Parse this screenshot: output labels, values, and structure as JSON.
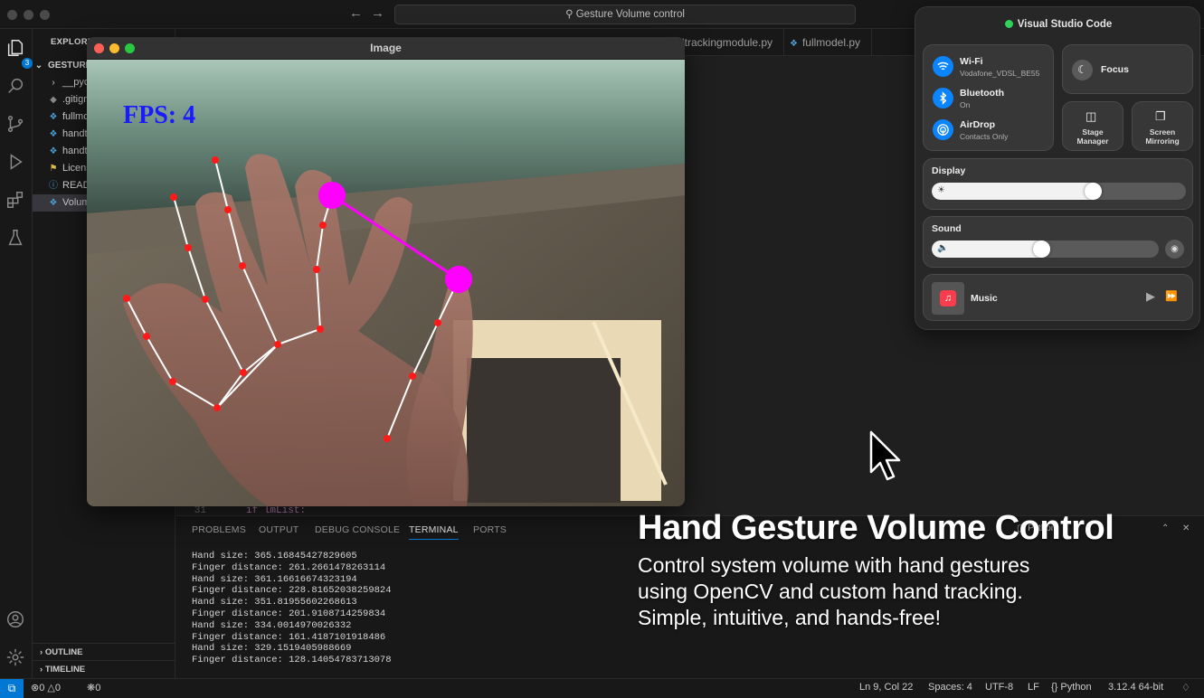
{
  "titlebar": {
    "search_text": "Gesture Volume control"
  },
  "activity": {
    "explorer_badge": "3"
  },
  "sidebar": {
    "header": "EXPLORER",
    "folder": "GESTURE",
    "items": [
      {
        "label": "__pycache__",
        "icon": "chevron-right-icon"
      },
      {
        "label": ".gitignore",
        "icon": "git-icon"
      },
      {
        "label": "fullmodel.py",
        "icon": "python-icon"
      },
      {
        "label": "handtracking.py",
        "icon": "python-icon"
      },
      {
        "label": "handtrackingmodule.py",
        "icon": "python-icon"
      },
      {
        "label": "License",
        "icon": "license-icon"
      },
      {
        "label": "README.md",
        "icon": "info-icon"
      },
      {
        "label": "Volume.py",
        "icon": "python-icon"
      }
    ],
    "outline": "OUTLINE",
    "timeline": "TIMELINE"
  },
  "editor": {
    "tabs": [
      {
        "label": "handtrackingmodule.py"
      },
      {
        "label": "fullmodel.py"
      }
    ],
    "line_number": "31",
    "line_code": "if lmList:"
  },
  "image_window": {
    "title": "Image",
    "fps_text": "FPS: 4"
  },
  "panel": {
    "tabs": [
      "PROBLEMS",
      "OUTPUT",
      "DEBUG CONSOLE",
      "TERMINAL",
      "PORTS"
    ],
    "active_tab": "TERMINAL",
    "shell_label": "Python",
    "terminal_lines": [
      "Hand size: 365.16845427829605",
      "Finger distance: 261.2661478263114",
      "Hand size: 361.16616674323194",
      "Finger distance: 228.81652038259824",
      "Hand size: 351.81955602268613",
      "Finger distance: 201.9108714259834",
      "Hand size: 334.0014970026332",
      "Finger distance: 161.4187101918486",
      "Hand size: 329.1519405988669",
      "Finger distance: 128.14054783713078"
    ]
  },
  "statusbar": {
    "errors": "0",
    "warnings": "0",
    "ports": "0",
    "position": "Ln 9, Col 22",
    "spaces": "Spaces: 4",
    "encoding": "UTF-8",
    "eol": "LF",
    "language": "Python",
    "interpreter": "3.12.4 64-bit"
  },
  "control_center": {
    "app_name": "Visual Studio Code",
    "wifi": {
      "label": "Wi-Fi",
      "sub": "Vodafone_VDSL_BE55"
    },
    "bluetooth": {
      "label": "Bluetooth",
      "sub": "On"
    },
    "airdrop": {
      "label": "AirDrop",
      "sub": "Contacts Only"
    },
    "focus": "Focus",
    "stage_manager": [
      "Stage",
      "Manager"
    ],
    "screen_mirroring": [
      "Screen",
      "Mirroring"
    ],
    "display": {
      "label": "Display",
      "level": 0.67
    },
    "sound": {
      "label": "Sound",
      "level": 0.52
    },
    "music": "Music"
  },
  "caption": {
    "title": "Hand Gesture Volume Control",
    "lines": [
      "Control system volume with hand gestures",
      "using OpenCV and custom hand tracking.",
      "Simple, intuitive, and hands-free!"
    ]
  },
  "colors": {
    "accent": "#0078d4",
    "landmark": "#ff1a1a",
    "pinch": "#ff00ff",
    "fps": "#1a1aff"
  }
}
